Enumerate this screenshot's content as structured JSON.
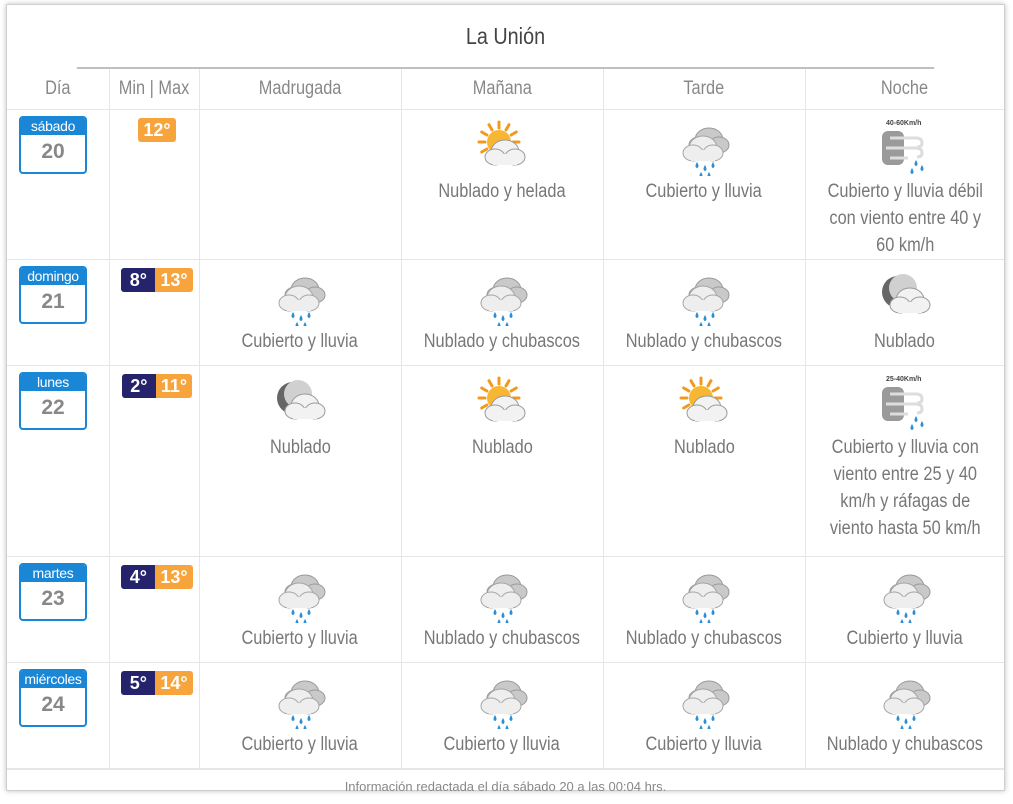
{
  "title": "La Unión",
  "headers": {
    "day": "Día",
    "minmax": "Min | Max",
    "madrugada": "Madrugada",
    "manana": "Mañana",
    "tarde": "Tarde",
    "noche": "Noche"
  },
  "rows": [
    {
      "day_name": "sábado",
      "day_num": "20",
      "min": "",
      "max": "12°",
      "periods": [
        {
          "icon": "",
          "desc": ""
        },
        {
          "icon": "sun-cloud-frost-icon",
          "desc": "Nublado y helada"
        },
        {
          "icon": "rain-cloud-icon",
          "desc": "Cubierto y lluvia"
        },
        {
          "icon": "wind-rain-icon",
          "wind": "40-60Km/h",
          "desc": "Cubierto y lluvia débil con viento entre 40 y 60 km/h"
        }
      ]
    },
    {
      "day_name": "domingo",
      "day_num": "21",
      "min": "8°",
      "max": "13°",
      "periods": [
        {
          "icon": "rain-cloud-icon",
          "desc": "Cubierto y lluvia"
        },
        {
          "icon": "shower-cloud-icon",
          "desc": "Nublado y chubascos"
        },
        {
          "icon": "shower-cloud-icon",
          "desc": "Nublado y chubascos"
        },
        {
          "icon": "night-cloud-icon",
          "desc": "Nublado"
        }
      ]
    },
    {
      "day_name": "lunes",
      "day_num": "22",
      "min": "2°",
      "max": "11°",
      "periods": [
        {
          "icon": "night-cloud-icon",
          "desc": "Nublado"
        },
        {
          "icon": "sun-cloud-icon",
          "desc": "Nublado"
        },
        {
          "icon": "sun-cloud-icon",
          "desc": "Nublado"
        },
        {
          "icon": "wind-rain-icon",
          "wind": "25-40Km/h",
          "desc": "Cubierto y lluvia con viento entre 25 y 40 km/h y ráfagas de viento hasta 50 km/h"
        }
      ]
    },
    {
      "day_name": "martes",
      "day_num": "23",
      "min": "4°",
      "max": "13°",
      "periods": [
        {
          "icon": "rain-cloud-icon",
          "desc": "Cubierto y lluvia"
        },
        {
          "icon": "shower-cloud-icon",
          "desc": "Nublado y chubascos"
        },
        {
          "icon": "shower-cloud-icon",
          "desc": "Nublado y chubascos"
        },
        {
          "icon": "rain-cloud-icon",
          "desc": "Cubierto y lluvia"
        }
      ]
    },
    {
      "day_name": "miércoles",
      "day_num": "24",
      "min": "5°",
      "max": "14°",
      "periods": [
        {
          "icon": "rain-cloud-icon",
          "desc": "Cubierto y lluvia"
        },
        {
          "icon": "rain-cloud-icon",
          "desc": "Cubierto y lluvia"
        },
        {
          "icon": "rain-cloud-icon",
          "desc": "Cubierto y lluvia"
        },
        {
          "icon": "shower-cloud-icon",
          "desc": "Nublado y chubascos"
        }
      ]
    }
  ],
  "footer": "Información redactada el día sábado 20 a las 00:04 hrs.",
  "colors": {
    "day_badge": "#1a87d6",
    "min_temp": "#24236b",
    "max_temp": "#f7a43c"
  }
}
